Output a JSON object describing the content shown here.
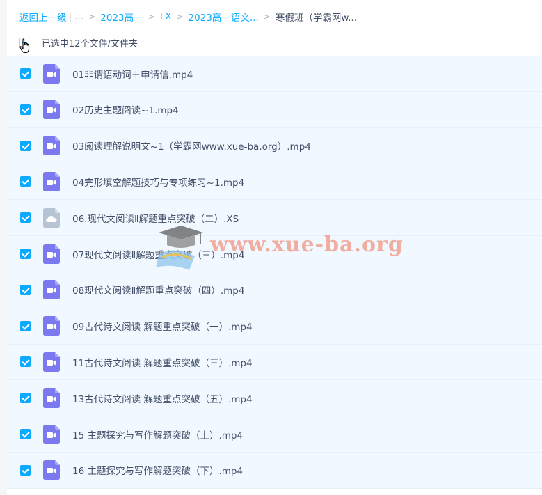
{
  "breadcrumb": {
    "back": "返回上一级",
    "ellipsis": "| ...",
    "items": [
      "2023高一",
      "LX",
      "2023高一语文..."
    ],
    "current": "寒假班（学霸网w..."
  },
  "selection": {
    "text": "已选中12个文件/文件夹"
  },
  "files": [
    {
      "name": "01非谓语动词＋申请信.mp4",
      "icon": "video-file-icon"
    },
    {
      "name": "02历史主题阅读~1.mp4",
      "icon": "video-file-icon"
    },
    {
      "name": "03阅读理解说明文~1（学霸网www.xue-ba.org）.mp4",
      "icon": "video-file-icon"
    },
    {
      "name": "04完形填空解题技巧与专项练习~1.mp4",
      "icon": "video-file-icon"
    },
    {
      "name": "06.现代文阅读Ⅱ解题重点突破（二）.XS",
      "icon": "cloud-file-icon"
    },
    {
      "name": "07现代文阅读Ⅱ解题重点突破（三）.mp4",
      "icon": "video-file-icon"
    },
    {
      "name": "08现代文阅读Ⅱ解题重点突破（四）.mp4",
      "icon": "video-file-icon"
    },
    {
      "name": "09古代诗文阅读 解题重点突破（一）.mp4",
      "icon": "video-file-icon"
    },
    {
      "name": "11古代诗文阅读 解题重点突破（三）.mp4",
      "icon": "video-file-icon"
    },
    {
      "name": "13古代诗文阅读 解题重点突破（五）.mp4",
      "icon": "video-file-icon"
    },
    {
      "name": "15 主题探究与写作解题突破（上）.mp4",
      "icon": "video-file-icon"
    },
    {
      "name": "16 主题探究与写作解题突破（下）.mp4",
      "icon": "video-file-icon"
    }
  ],
  "watermark": {
    "text": "www.xue-ba.org"
  },
  "colors": {
    "accent": "#09aaff",
    "video_icon": "#7b78f0",
    "cloud_icon": "#b6c4d4",
    "row_bg": "#f1f8ff"
  }
}
